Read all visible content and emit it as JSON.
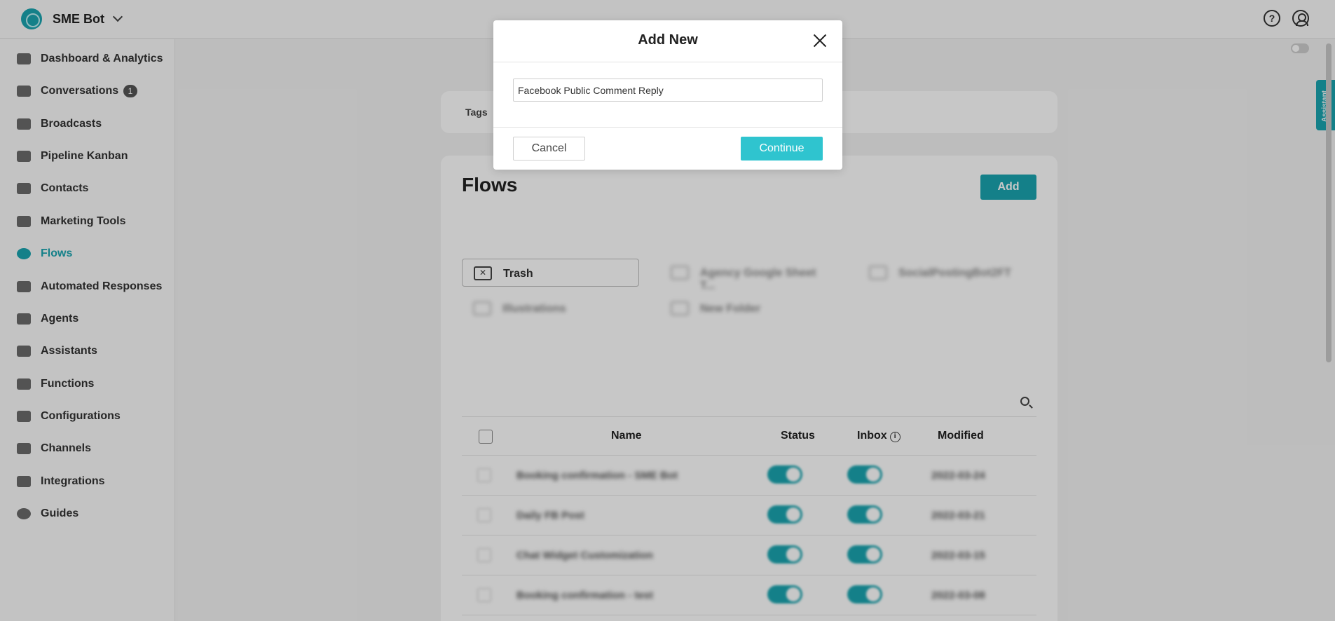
{
  "app": {
    "name": "SME Bot"
  },
  "sidebar": {
    "items": [
      {
        "label": "Dashboard & Analytics",
        "icon": "pie-chart-icon"
      },
      {
        "label": "Conversations",
        "icon": "chat-icon",
        "badge": "1"
      },
      {
        "label": "Broadcasts",
        "icon": "megaphone-icon"
      },
      {
        "label": "Pipeline Kanban",
        "icon": "kanban-icon"
      },
      {
        "label": "Contacts",
        "icon": "contact-card-icon"
      },
      {
        "label": "Marketing Tools",
        "icon": "store-icon"
      },
      {
        "label": "Flows",
        "icon": "flow-icon",
        "active": true
      },
      {
        "label": "Automated Responses",
        "icon": "auto-response-icon"
      },
      {
        "label": "Agents",
        "icon": "agent-icon"
      },
      {
        "label": "Assistants",
        "icon": "assistant-icon"
      },
      {
        "label": "Functions",
        "icon": "function-icon"
      },
      {
        "label": "Configurations",
        "icon": "sliders-icon"
      },
      {
        "label": "Channels",
        "icon": "channels-icon"
      },
      {
        "label": "Integrations",
        "icon": "gears-icon"
      },
      {
        "label": "Guides",
        "icon": "info-icon"
      }
    ]
  },
  "assistant_tab": "Assistant",
  "tags": {
    "label": "Tags"
  },
  "flows": {
    "title": "Flows",
    "add_label": "Add",
    "folders": [
      {
        "label": "Trash"
      },
      {
        "label": "Agency Google Sheet T..."
      },
      {
        "label": "SocialPostingBot2FT"
      },
      {
        "label": "Illustrations"
      },
      {
        "label": "New Folder"
      }
    ],
    "columns": [
      "Name",
      "Status",
      "Inbox",
      "Modified"
    ],
    "rows": [
      {
        "name": "Booking confirmation - SME Bot",
        "modified": "2022-03-24"
      },
      {
        "name": "Daily FB Post",
        "modified": "2022-03-21"
      },
      {
        "name": "Chat Widget Customization",
        "modified": "2022-03-15"
      },
      {
        "name": "Booking confirmation - test",
        "modified": "2022-03-08"
      }
    ]
  },
  "modal": {
    "title": "Add New",
    "input_value": "Facebook Public Comment Reply",
    "cancel_label": "Cancel",
    "continue_label": "Continue"
  },
  "colors": {
    "accent": "#1aa5b0",
    "continue": "#2fc4cf"
  }
}
